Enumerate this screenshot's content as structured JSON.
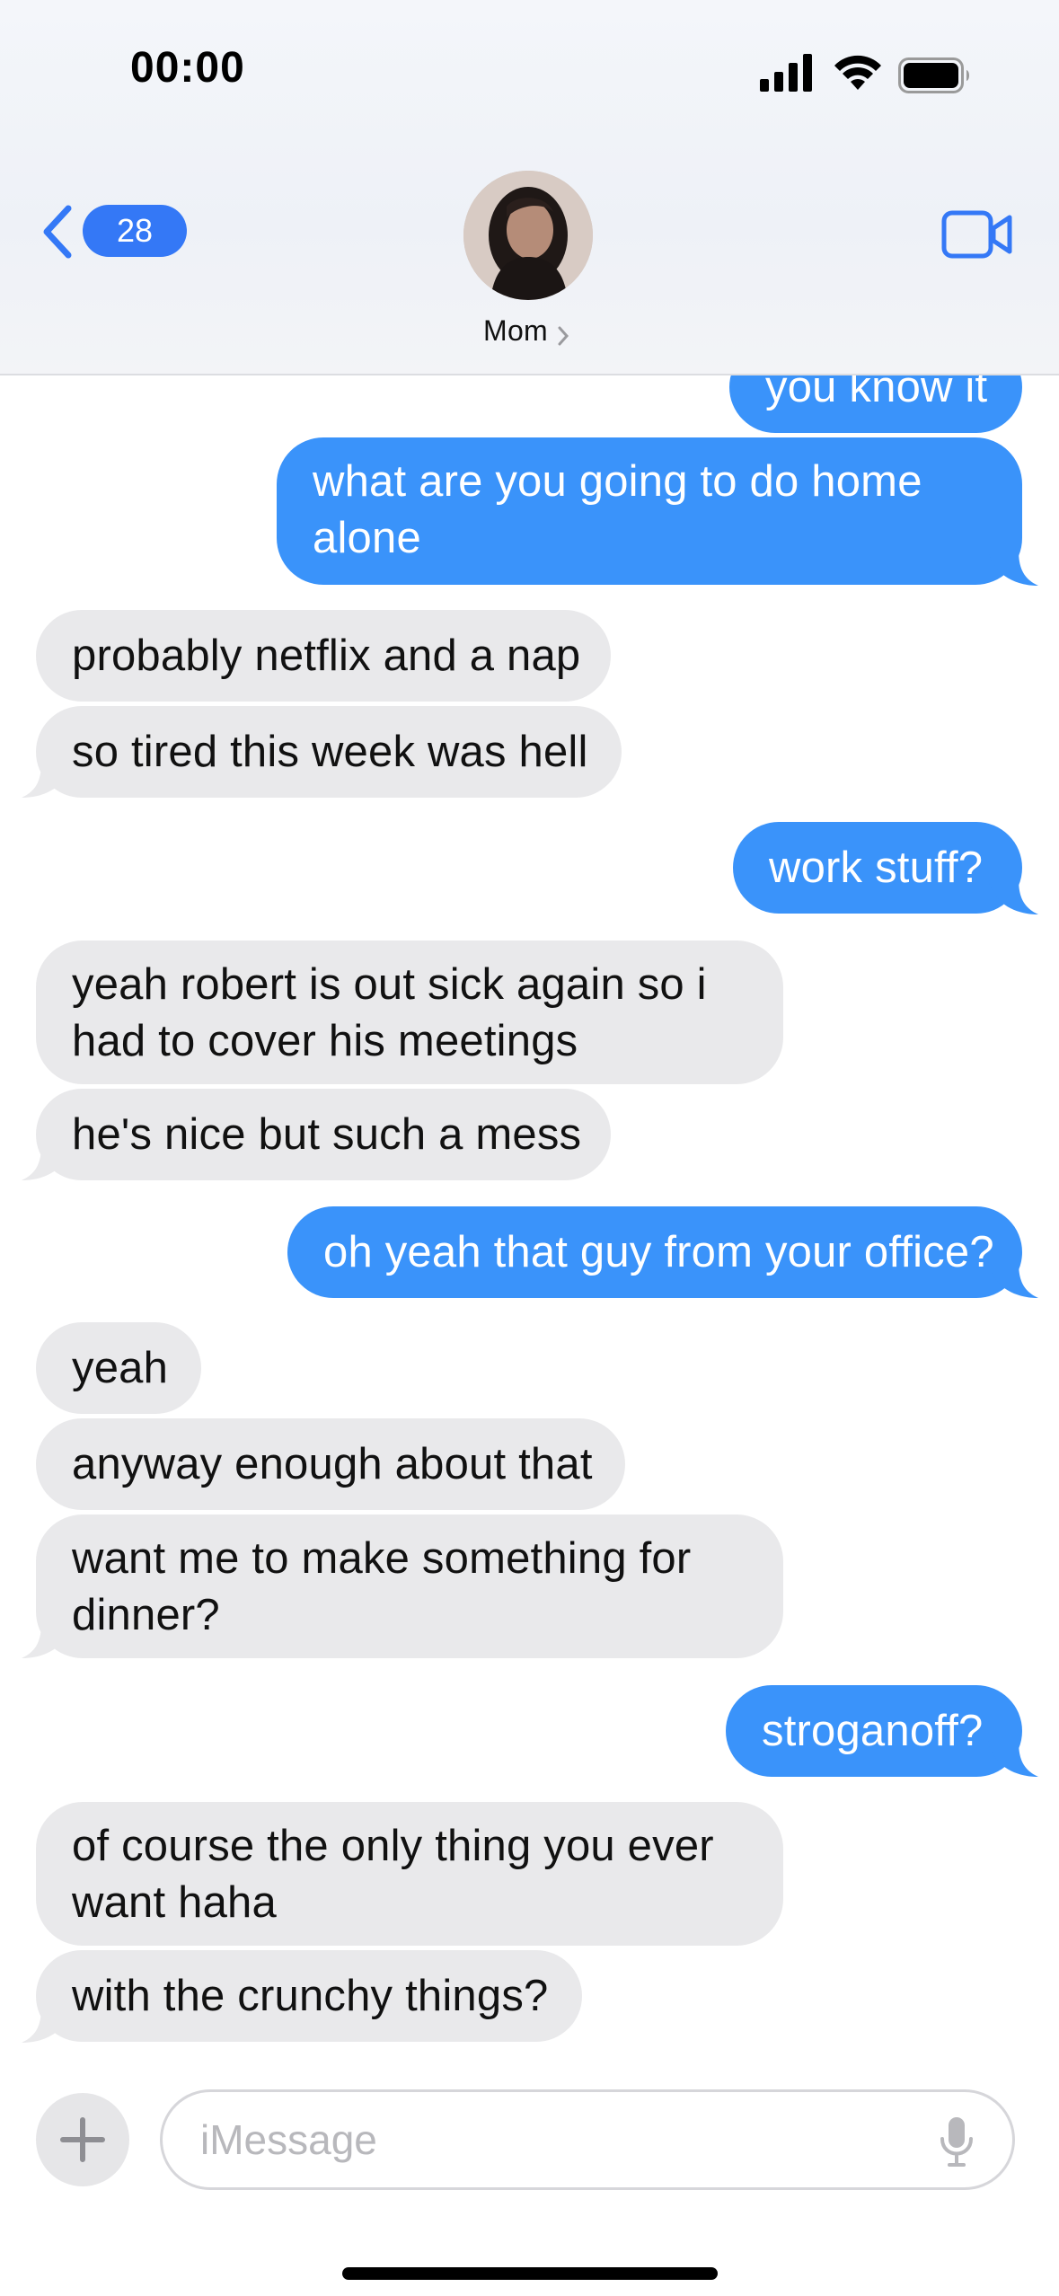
{
  "status_bar": {
    "time": "00:00"
  },
  "header": {
    "back_badge": "28",
    "contact_name": "Mom"
  },
  "messages": [
    {
      "from": "me",
      "text": "you know it"
    },
    {
      "from": "me",
      "lines": [
        "what are you going to do home",
        "alone"
      ]
    },
    {
      "from": "them",
      "text": "probably netflix and a nap"
    },
    {
      "from": "them",
      "text": "so tired this week was hell"
    },
    {
      "from": "me",
      "text": "work stuff?"
    },
    {
      "from": "them",
      "lines": [
        "yeah robert is out sick again so i",
        "had to cover his meetings"
      ]
    },
    {
      "from": "them",
      "text": "he's nice but such a mess"
    },
    {
      "from": "me",
      "text": "oh yeah that guy from your office?"
    },
    {
      "from": "them",
      "text": "yeah"
    },
    {
      "from": "them",
      "text": "anyway enough about that"
    },
    {
      "from": "them",
      "lines": [
        "want me to make something for",
        "dinner?"
      ]
    },
    {
      "from": "me",
      "text": "stroganoff?"
    },
    {
      "from": "them",
      "lines": [
        "of course the only thing you ever",
        "want haha"
      ]
    },
    {
      "from": "them",
      "text": "with the crunchy things?"
    }
  ],
  "input": {
    "placeholder": "iMessage"
  },
  "icons": {
    "back": "chevron-left-icon",
    "video": "video-camera-icon",
    "add": "plus-icon",
    "mic": "microphone-icon"
  },
  "colors": {
    "outgoing_bubble": "#3a93fa",
    "incoming_bubble": "#e9e9eb",
    "badge": "#3478f6",
    "accent": "#3478f6"
  }
}
